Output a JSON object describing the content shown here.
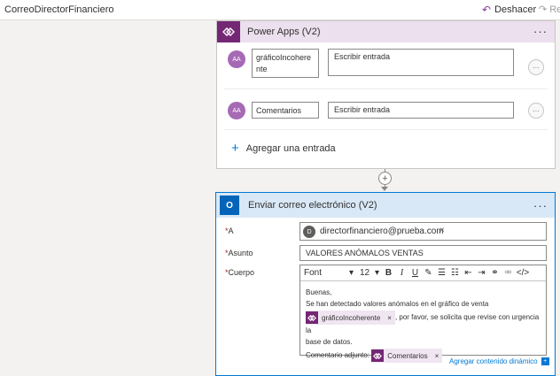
{
  "topbar": {
    "flow_name": "CorreoDirectorFinanciero",
    "undo_label": "Deshacer",
    "redo_label": "Re"
  },
  "powerapps_card": {
    "title": "Power Apps (V2)",
    "menu_glyph": "···",
    "entries": [
      {
        "avatar_text": "AA",
        "name": "gráficoIncoherente",
        "value_placeholder": "Escribir entrada",
        "menu_glyph": "···"
      },
      {
        "avatar_text": "AA",
        "name": "Comentarios",
        "value_placeholder": "Escribir entrada",
        "menu_glyph": "···"
      }
    ],
    "add_entry_label": "Agregar una entrada"
  },
  "connector": {
    "plus_glyph": "+"
  },
  "mail_card": {
    "title": "Enviar correo electrónico (V2)",
    "menu_glyph": "···",
    "to": {
      "label": "A",
      "avatar_text": "D",
      "email": "directorfinanciero@prueba.com",
      "remove_glyph": "×"
    },
    "subject": {
      "label": "Asunto",
      "value": "VALORES ANÓMALOS VENTAS"
    },
    "body": {
      "label": "Cuerpo",
      "toolbar": {
        "font": "Font",
        "size": "12"
      },
      "line1": "Buenas,",
      "line2": "Se han detectado valores anómalos en el gráfico de venta",
      "token1": "gráficoIncoherente",
      "line3": ", por favor, se solicita que revise con urgencia la",
      "line4": "base de datos.",
      "line5_prefix": "Comentario adjunto:",
      "token2": "Comentarios",
      "token_remove_glyph": "×"
    },
    "dynamic_content_label": "Agregar contenido dinámico",
    "dynamic_content_glyph": "+"
  },
  "colors": {
    "powerapps_purple": "#742774",
    "powerapps_header": "#ecdfee",
    "outlook_blue": "#0364b8",
    "mail_header": "#d9e8f6",
    "link_blue": "#0078d4"
  },
  "icons": {
    "undo": "undo-icon",
    "redo": "redo-icon",
    "powerapps": "powerapps-icon",
    "outlook": "outlook-icon"
  }
}
